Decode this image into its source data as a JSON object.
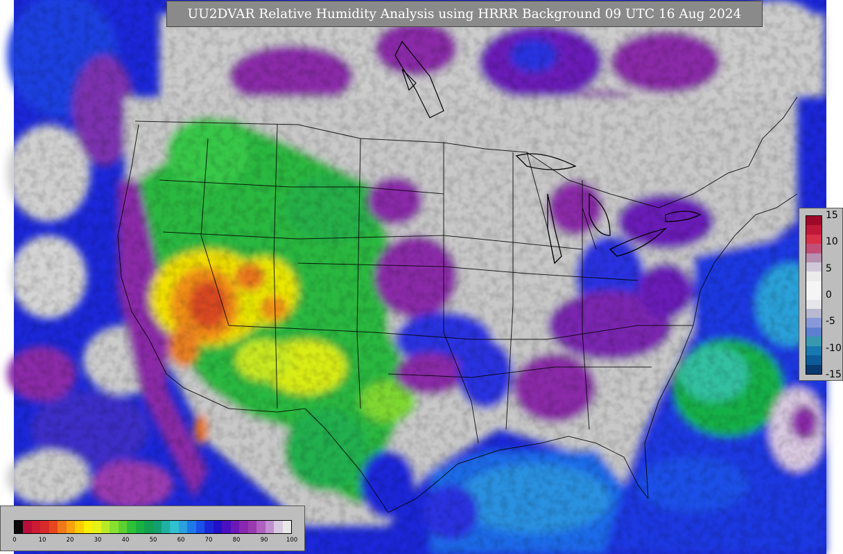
{
  "title": "UU2DVAR Relative Humidity Analysis using HRRR Background 09 UTC 16 Aug 2024",
  "colors": {
    "map_frame": "#1b27d8",
    "land_gray": "#cccccc",
    "humid_purple": "#8a2aa8",
    "humid_blue": "#1b27d8",
    "moist_cyan": "#2aa8d8",
    "mid_green": "#22b14c",
    "dry_yellow": "#f2e600",
    "very_dry_orange": "#e8761c",
    "driest_red": "#c8302c",
    "borders": "#000000"
  },
  "rh_colorbar": {
    "ticks": [
      "0",
      "10",
      "20",
      "30",
      "40",
      "50",
      "60",
      "70",
      "80",
      "90",
      "100"
    ],
    "colors": [
      "#0a0a0a",
      "#b80f3a",
      "#cc1a32",
      "#d82a2a",
      "#e8461e",
      "#f07818",
      "#f8a010",
      "#ffcc00",
      "#ffee00",
      "#e6f218",
      "#b8ea28",
      "#88e030",
      "#5cd030",
      "#30c038",
      "#18b040",
      "#10a050",
      "#10a070",
      "#20b0a0",
      "#30c0d0",
      "#2aa0e0",
      "#1e78e8",
      "#1a50e8",
      "#1a28d8",
      "#2210c8",
      "#4a10c0",
      "#6a18b8",
      "#8828b0",
      "#9a3ab0",
      "#b060c0",
      "#c090d0",
      "#d8c8e0",
      "#e8e8e8"
    ]
  },
  "diff_colorbar": {
    "ticks": [
      "15",
      "10",
      "5",
      "0",
      "-5",
      "-10",
      "-15"
    ],
    "colors": [
      "#a0082a",
      "#c01838",
      "#d83048",
      "#c05078",
      "#b890b0",
      "#d0c8d8",
      "#ebebeb",
      "#f5f5f5",
      "#f5f5f5",
      "#e6e6ea",
      "#b8b8d0",
      "#8898d8",
      "#5c80d0",
      "#3898b0",
      "#1878b0",
      "#0c5c98",
      "#083a70"
    ]
  }
}
